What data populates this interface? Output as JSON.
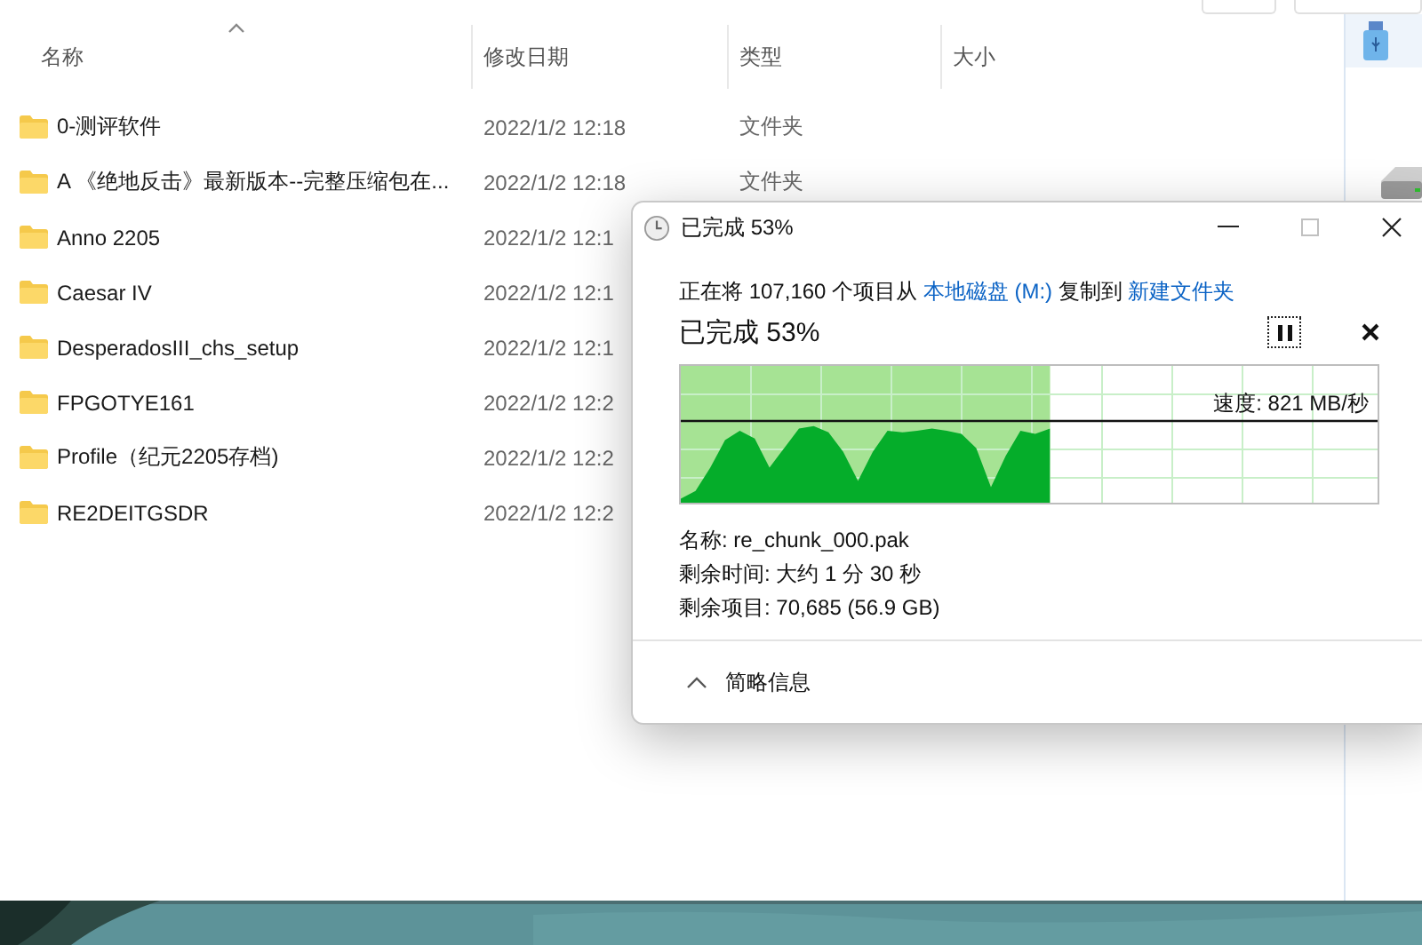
{
  "explorer": {
    "columns": [
      {
        "label": "名称",
        "sorted": true
      },
      {
        "label": "修改日期",
        "sorted": false
      },
      {
        "label": "类型",
        "sorted": false
      },
      {
        "label": "大小",
        "sorted": false
      }
    ],
    "rows": [
      {
        "name": "0-测评软件",
        "date": "2022/1/2 12:18",
        "type": "文件夹"
      },
      {
        "name": "A 《绝地反击》最新版本--完整压缩包在...",
        "date": "2022/1/2 12:18",
        "type": "文件夹"
      },
      {
        "name": "Anno 2205",
        "date": "2022/1/2 12:1"
      },
      {
        "name": "Caesar IV",
        "date": "2022/1/2 12:1"
      },
      {
        "name": "DesperadosIII_chs_setup",
        "date": "2022/1/2 12:1"
      },
      {
        "name": "FPGOTYE161",
        "date": "2022/1/2 12:2"
      },
      {
        "name": "Profile（纪元2205存档)",
        "date": "2022/1/2 12:2"
      },
      {
        "name": "RE2DEITGSDR",
        "date": "2022/1/2 12:2"
      }
    ]
  },
  "dialog": {
    "title": "已完成 53%",
    "copy_line": {
      "prefix": "正在将 107,160 个项目从",
      "source": "本地磁盘 (M:)",
      "middle": "复制到",
      "target": "新建文件夹"
    },
    "progress_heading": "已完成 53%",
    "level": 0.53,
    "speed": "速度: 821 MB/秒",
    "details": [
      "名称: re_chunk_000.pak",
      "剩余时间: 大约 1 分 30 秒",
      "剩余项目: 70,685 (56.9 GB)"
    ],
    "more_info": {
      "label": "简略信息",
      "expanded": true
    }
  }
}
